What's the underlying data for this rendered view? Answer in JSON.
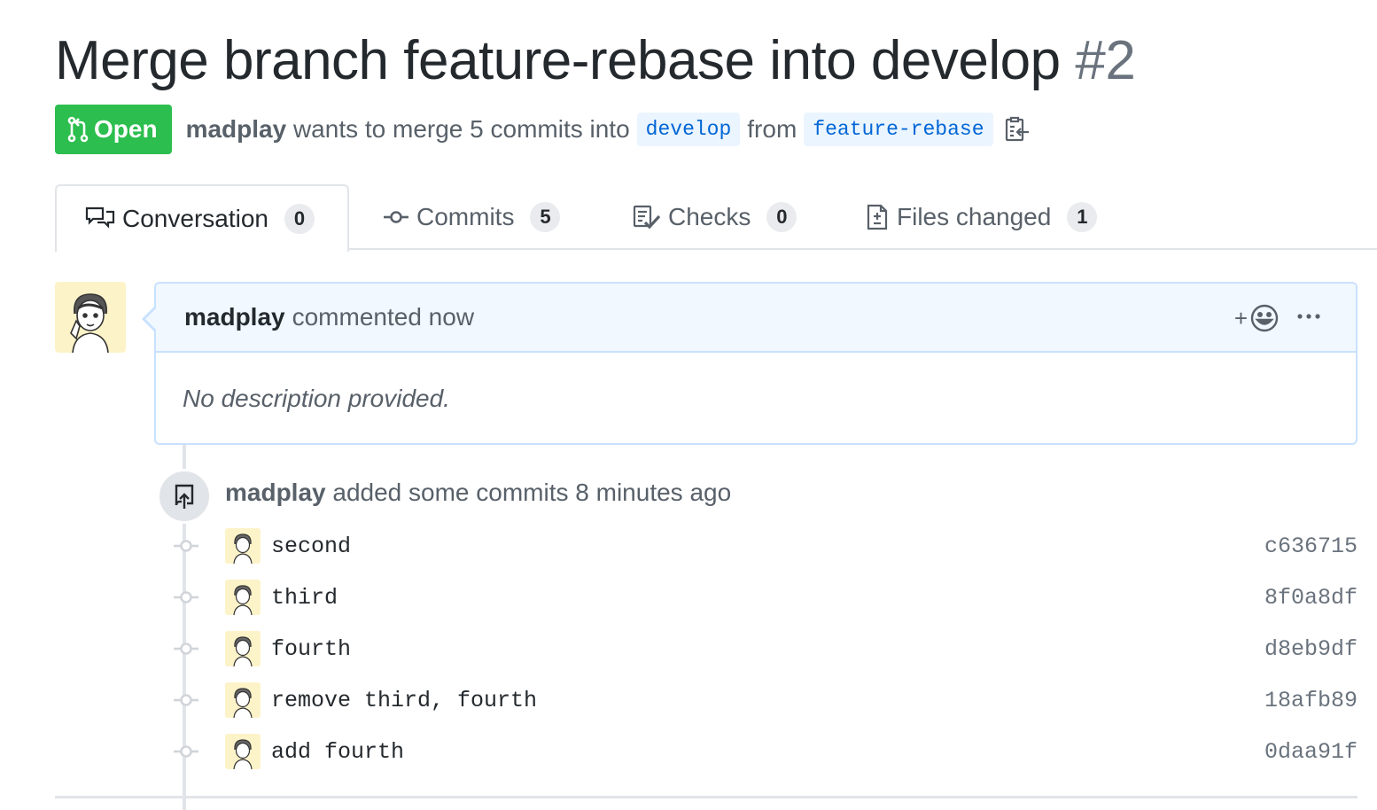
{
  "pr": {
    "title": "Merge branch feature-rebase into develop",
    "number": "#2",
    "state": "Open",
    "author": "madplay",
    "merge_text": "wants to merge 5 commits into",
    "base_branch": "develop",
    "from_text": "from",
    "head_branch": "feature-rebase"
  },
  "tabs": [
    {
      "label": "Conversation",
      "count": "0"
    },
    {
      "label": "Commits",
      "count": "5"
    },
    {
      "label": "Checks",
      "count": "0"
    },
    {
      "label": "Files changed",
      "count": "1"
    }
  ],
  "comment": {
    "author": "madplay",
    "action": "commented now",
    "reaction_plus": "+",
    "body": "No description provided."
  },
  "event": {
    "author": "madplay",
    "text": "added some commits 8 minutes ago"
  },
  "commits": [
    {
      "message": "second",
      "sha": "c636715"
    },
    {
      "message": "third",
      "sha": "8f0a8df"
    },
    {
      "message": "fourth",
      "sha": "d8eb9df"
    },
    {
      "message": "remove third, fourth",
      "sha": "18afb89"
    },
    {
      "message": "add fourth",
      "sha": "0daa91f"
    }
  ],
  "colors": {
    "open_green": "#2cbe4e",
    "branch_blue": "#0366d6",
    "branch_bg": "#eaf5ff",
    "comment_border": "#c8e1ff",
    "comment_header_bg": "#f1f8ff"
  },
  "icons": {
    "state": "git-pull-request-icon",
    "copy": "clipboard-copy-icon",
    "conversation": "comment-discussion-icon",
    "commits": "git-commit-icon",
    "checks": "checklist-icon",
    "files": "file-diff-icon",
    "reaction": "smiley-icon",
    "more": "kebab-horizontal-icon",
    "event": "repo-push-icon"
  }
}
